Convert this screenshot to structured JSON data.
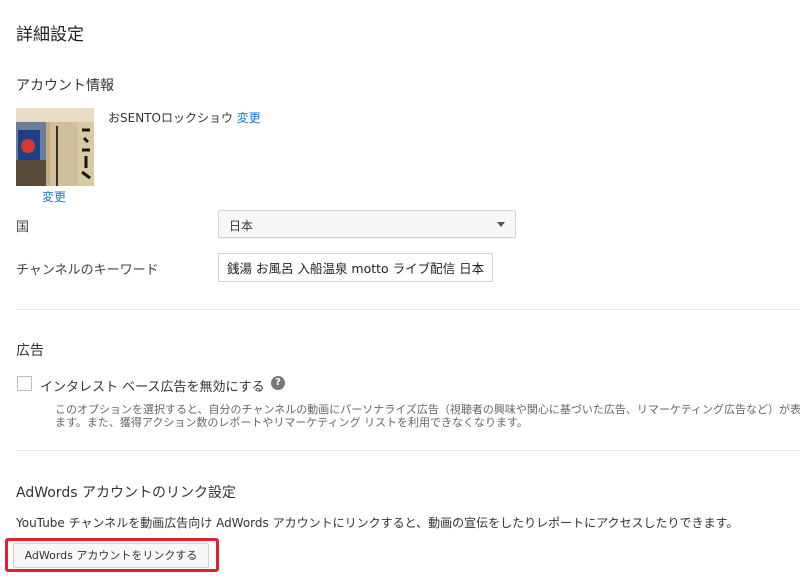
{
  "page_title": "詳細設定",
  "account": {
    "section_title": "アカウント情報",
    "channel_name": "おSENTOロックショウ",
    "change_name_link": "変更",
    "change_avatar_link": "変更"
  },
  "country": {
    "label": "国",
    "selected": "日本"
  },
  "keywords": {
    "label": "チャンネルのキーワード",
    "value": "銭湯 お風呂 入船温泉 motto ライブ配信 日本"
  },
  "ads": {
    "section_title": "広告",
    "checkbox_label": "インタレスト ベース広告を無効にする",
    "checked": false,
    "description_line1": "このオプションを選択すると、自分のチャンネルの動画にパーソナライズ広告（視聴者の興味や関心に基づいた広告、リマーケティング広告など）が表",
    "description_line2": "ます。また、獲得アクション数のレポートやリマーケティング リストを利用できなくなります。"
  },
  "adwords": {
    "section_title": "AdWords アカウントのリンク設定",
    "description": "YouTube チャンネルを動画広告向け AdWords アカウントにリンクすると、動画の宣伝をしたりレポートにアクセスしたりできます。",
    "button_label": "AdWords アカウントをリンクする"
  },
  "colors": {
    "link": "#167ac6",
    "highlight": "#e0202c"
  }
}
